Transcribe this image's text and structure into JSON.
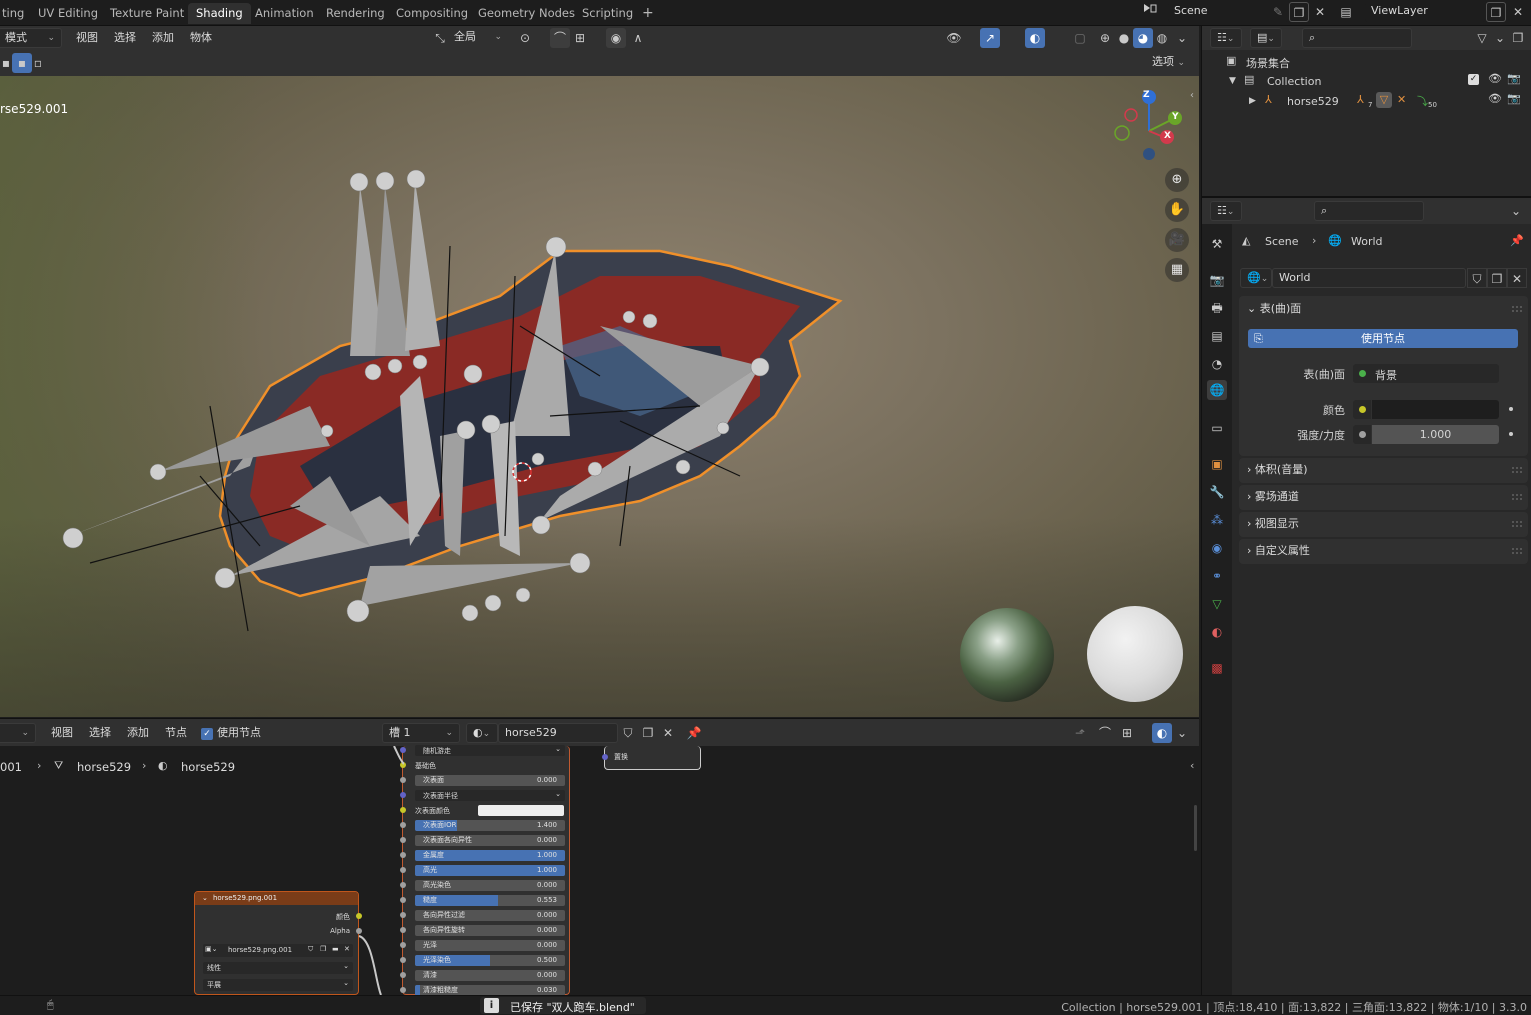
{
  "topbar": {
    "workspace_tabs": [
      "ting",
      "UV Editing",
      "Texture Paint",
      "Shading",
      "Animation",
      "Rendering",
      "Compositing",
      "Geometry Nodes",
      "Scripting"
    ],
    "add_tab": "+",
    "scene_name": "Scene",
    "view_layer": "ViewLayer"
  },
  "viewport_header": {
    "mode": "模式",
    "menus": [
      "视图",
      "选择",
      "添加",
      "物体"
    ],
    "transform_orientation": "全局",
    "options_label": "选项"
  },
  "viewport": {
    "object_label": "rse529.001",
    "gizmo": {
      "x": "X",
      "y": "Y",
      "z": "Z"
    }
  },
  "node_editor": {
    "menus": [
      "视图",
      "选择",
      "添加",
      "节点"
    ],
    "use_nodes_label": "使用节点",
    "slot": "槽 1",
    "material": "horse529",
    "breadcrumb": [
      "001",
      "horse529",
      "horse529"
    ],
    "bsdf_rows": [
      {
        "label": "随机游走",
        "type": "dropdown"
      },
      {
        "label": "基础色",
        "type": "label"
      },
      {
        "label": "次表面",
        "value": "0.000",
        "fill": 0
      },
      {
        "label": "次表面半径",
        "type": "dropdown"
      },
      {
        "label": "次表面颜色",
        "type": "color"
      },
      {
        "label": "次表面IOR",
        "value": "1.400",
        "fill": 0.28
      },
      {
        "label": "次表面各向异性",
        "value": "0.000",
        "fill": 0
      },
      {
        "label": "金属度",
        "value": "1.000",
        "fill": 1
      },
      {
        "label": "高光",
        "value": "1.000",
        "fill": 1
      },
      {
        "label": "高光染色",
        "value": "0.000",
        "fill": 0
      },
      {
        "label": "糙度",
        "value": "0.553",
        "fill": 0.553
      },
      {
        "label": "各向异性过滤",
        "value": "0.000",
        "fill": 0
      },
      {
        "label": "各向异性旋转",
        "value": "0.000",
        "fill": 0
      },
      {
        "label": "光泽",
        "value": "0.000",
        "fill": 0
      },
      {
        "label": "光泽染色",
        "value": "0.500",
        "fill": 0.5
      },
      {
        "label": "清漆",
        "value": "0.000",
        "fill": 0
      },
      {
        "label": "清漆粗糙度",
        "value": "0.030",
        "fill": 0.03
      }
    ],
    "output_node_label": "置换",
    "image_node": {
      "title": "horse529.png.001",
      "out_color": "颜色",
      "out_alpha": "Alpha",
      "image_name": "horse529.png.001",
      "interpolation": "线性",
      "projection": "平展"
    }
  },
  "outliner": {
    "root": "场景集合",
    "collection": "Collection",
    "object": "horse529",
    "modifier_count": "7",
    "vertex_groups": "50"
  },
  "properties": {
    "breadcrumb_scene": "Scene",
    "breadcrumb_world": "World",
    "world_name": "World",
    "surface_panel": "表(曲)面",
    "use_nodes_button": "使用节点",
    "surface_label": "表(曲)面",
    "surface_value": "背景",
    "color_label": "颜色",
    "strength_label": "强度/力度",
    "strength_value": "1.000",
    "collapsed_panels": [
      "体积(音量)",
      "雾场通道",
      "视图显示",
      "自定义属性"
    ]
  },
  "statusbar": {
    "saved_message": "已保存 \"双人跑车.blend\"",
    "stats": "Collection | horse529.001 | 顶点:18,410 | 面:13,822 | 三角面:13,822 | 物体:1/10 | 3.3.0"
  },
  "colors": {
    "accent": "#4772b3",
    "selected_outline": "#f0902a",
    "active_tab": "#303030"
  }
}
